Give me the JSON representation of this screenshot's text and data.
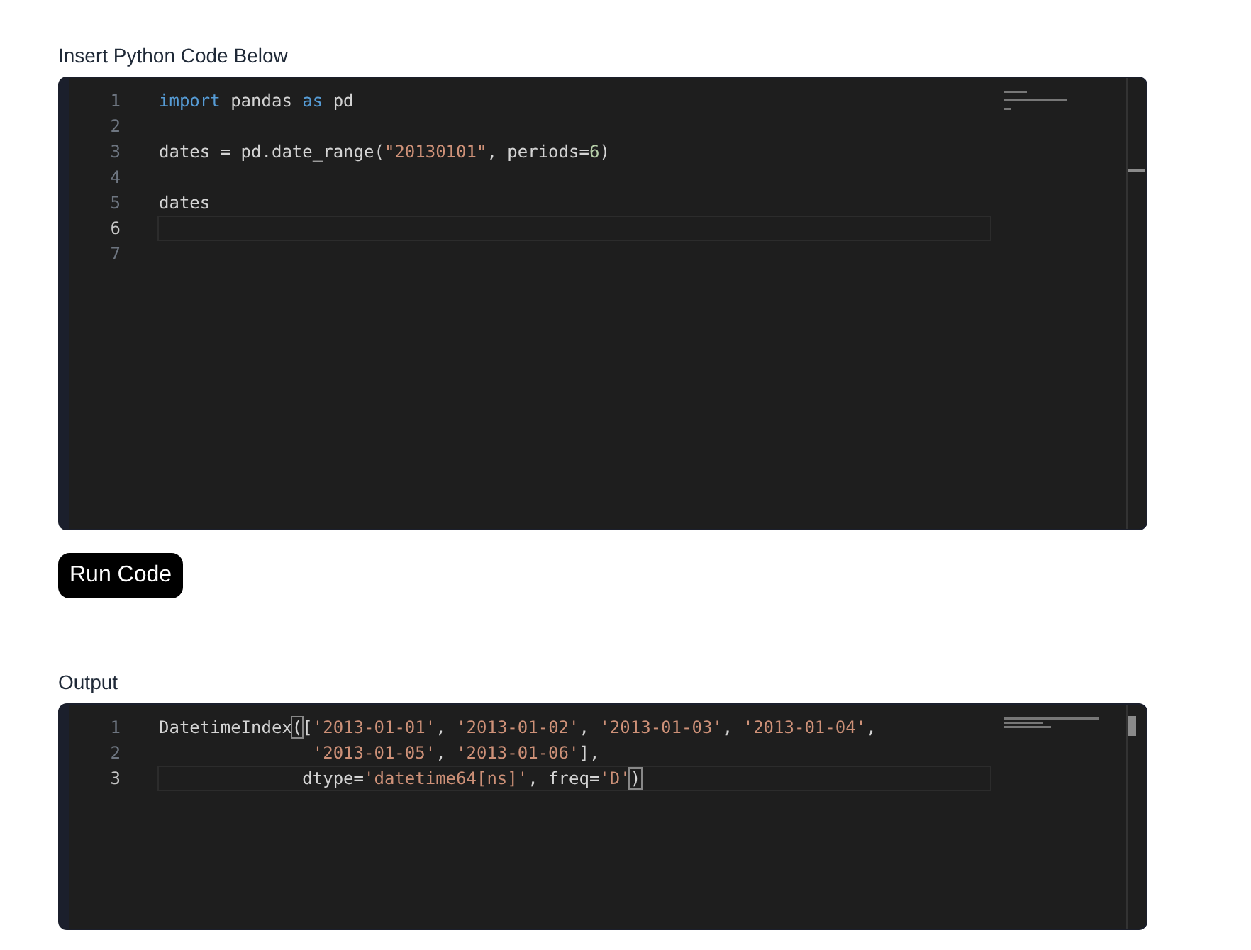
{
  "sections": [
    {
      "label": "Insert Python Code Below",
      "kind": "editor",
      "lines": [
        {
          "number": "1",
          "current": false,
          "tokens": [
            {
              "text": "import",
              "kind": "keyword"
            },
            {
              "text": " pandas ",
              "kind": "plain"
            },
            {
              "text": "as",
              "kind": "keyword"
            },
            {
              "text": " pd",
              "kind": "plain"
            }
          ]
        },
        {
          "number": "2",
          "current": false
        },
        {
          "number": "3",
          "current": false,
          "tokens": [
            {
              "text": "dates = pd.date_range(",
              "kind": "plain"
            },
            {
              "text": "\"20130101\"",
              "kind": "string"
            },
            {
              "text": ", periods=",
              "kind": "plain"
            },
            {
              "text": "6",
              "kind": "number"
            },
            {
              "text": ")",
              "kind": "plain"
            }
          ]
        },
        {
          "number": "4",
          "current": false
        },
        {
          "number": "5",
          "current": false,
          "tokens": [
            {
              "text": "dates",
              "kind": "plain"
            }
          ]
        },
        {
          "number": "6",
          "current": true
        },
        {
          "number": "7",
          "current": false
        }
      ]
    },
    {
      "label": "Output",
      "kind": "output",
      "lines": [
        {
          "number": "1",
          "current": false,
          "tokens": [
            {
              "text": "DatetimeIndex",
              "kind": "plain"
            },
            {
              "text": "(",
              "kind": "bracket"
            },
            {
              "text": "[",
              "kind": "plain"
            },
            {
              "text": "'2013-01-01'",
              "kind": "string"
            },
            {
              "text": ", ",
              "kind": "plain"
            },
            {
              "text": "'2013-01-02'",
              "kind": "string"
            },
            {
              "text": ", ",
              "kind": "plain"
            },
            {
              "text": "'2013-01-03'",
              "kind": "string"
            },
            {
              "text": ", ",
              "kind": "plain"
            },
            {
              "text": "'2013-01-04'",
              "kind": "string"
            },
            {
              "text": ",",
              "kind": "plain"
            }
          ]
        },
        {
          "number": "2",
          "current": false,
          "tokens": [
            {
              "text": "               '2013-01-05'",
              "kind": "string"
            },
            {
              "text": ", ",
              "kind": "plain"
            },
            {
              "text": "'2013-01-06'",
              "kind": "string"
            },
            {
              "text": "],",
              "kind": "plain"
            }
          ]
        },
        {
          "number": "3",
          "current": true,
          "tokens": [
            {
              "text": "              dtype=",
              "kind": "plain"
            },
            {
              "text": "'datetime64[ns]'",
              "kind": "string"
            },
            {
              "text": ", freq=",
              "kind": "plain"
            },
            {
              "text": "'D'",
              "kind": "string"
            },
            {
              "text": ")",
              "kind": "bracket"
            }
          ]
        }
      ]
    }
  ],
  "run_button": "Run Code"
}
